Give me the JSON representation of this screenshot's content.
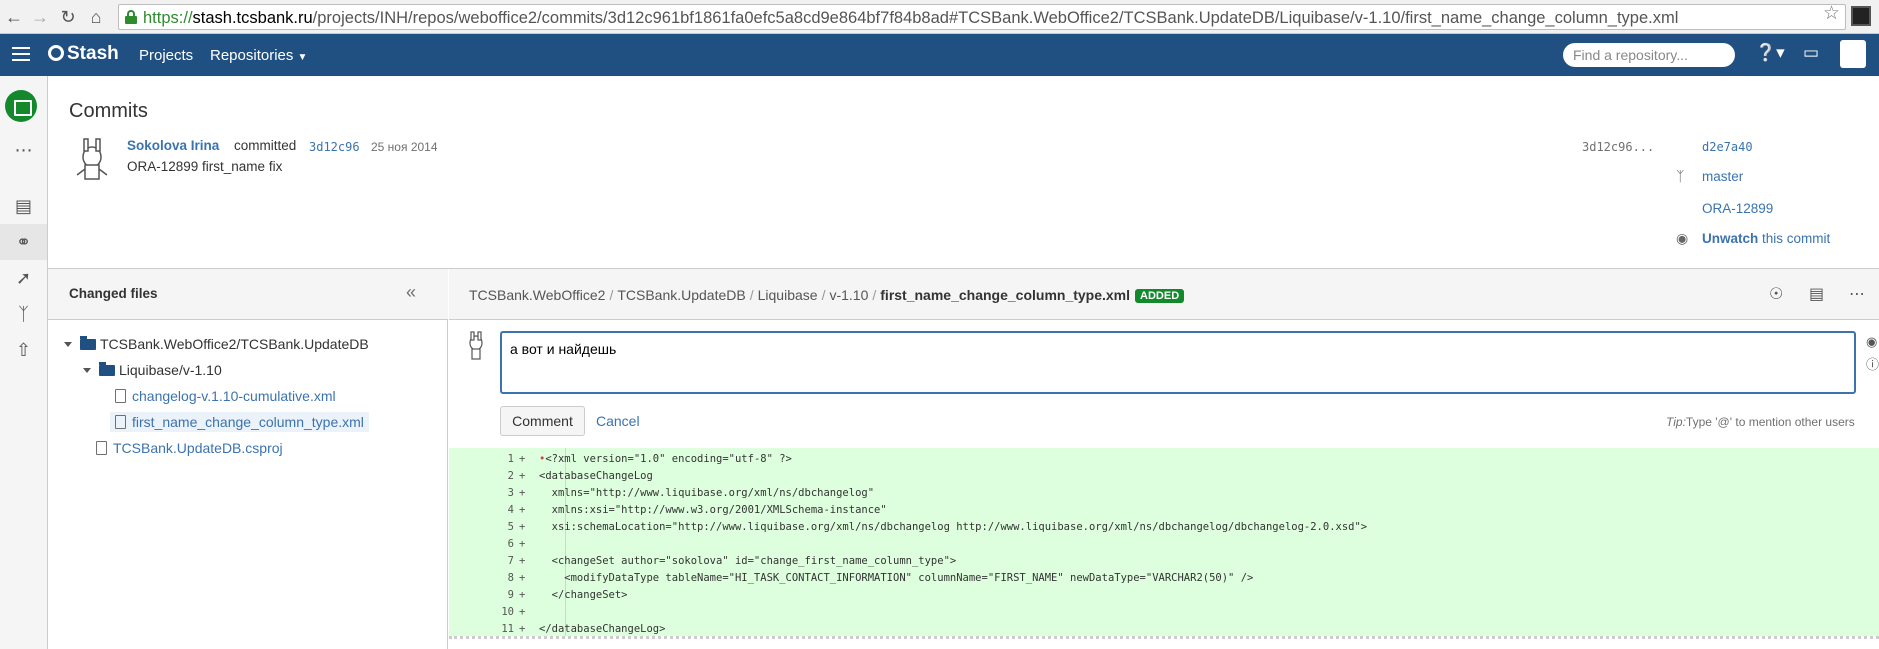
{
  "browser": {
    "url_scheme": "https://",
    "url_host": "stash.tcsbank.ru",
    "url_path": "/projects/INH/repos/weboffice2/commits/3d12c961bf1861fa0efc5a8cd9e864bf7f84b8ad#TCSBank.WebOffice2/TCSBank.UpdateDB/Liquibase/v-1.10/first_name_change_column_type.xml",
    "back_icon": "arrow-left-icon",
    "forward_icon": "arrow-right-icon",
    "reload_icon": "reload-icon",
    "home_icon": "home-icon",
    "star_icon": "bookmark-star-icon"
  },
  "header": {
    "logo": "Stash",
    "nav": [
      "Projects",
      "Repositories"
    ],
    "search_placeholder": "Find a repository...",
    "brand_color": "#205081"
  },
  "commit": {
    "page_title": "Commits",
    "author": "Sokolova Irina",
    "verb": "committed",
    "hash": "3d12c96",
    "date": "25 ноя 2014",
    "message": "ORA-12899 first_name fix",
    "parent_hash": "3d12c96...",
    "child_hash": "d2e7a40",
    "branch": "master",
    "issue": "ORA-12899",
    "unwatch_label": "Unwatch",
    "unwatch_suffix": "this commit"
  },
  "files": {
    "title": "Changed files",
    "tree": [
      {
        "label": "TCSBank.WebOffice2/TCSBank.UpdateDB",
        "type": "folder"
      },
      {
        "label": "Liquibase/v-1.10",
        "type": "folder"
      },
      {
        "label": "changelog-v.1.10-cumulative.xml",
        "type": "file"
      },
      {
        "label": "first_name_change_column_type.xml",
        "type": "file",
        "selected": true
      },
      {
        "label": "TCSBank.UpdateDB.csproj",
        "type": "file"
      }
    ]
  },
  "diff": {
    "crumbs": [
      "TCSBank.WebOffice2",
      "TCSBank.UpdateDB",
      "Liquibase",
      "v-1.10"
    ],
    "current_file": "first_name_change_column_type.xml",
    "badge": "ADDED",
    "comment_text": "а вот и найдешь",
    "comment_button": "Comment",
    "cancel_link": "Cancel",
    "tip_label": "Tip:",
    "tip_text": "Type '@' to mention other users",
    "lines": [
      {
        "n": "1",
        "text": "<?xml version=\"1.0\" encoding=\"utf-8\" ?>"
      },
      {
        "n": "2",
        "text": "<databaseChangeLog"
      },
      {
        "n": "3",
        "text": "  xmlns=\"http://www.liquibase.org/xml/ns/dbchangelog\""
      },
      {
        "n": "4",
        "text": "  xmlns:xsi=\"http://www.w3.org/2001/XMLSchema-instance\""
      },
      {
        "n": "5",
        "text": "  xsi:schemaLocation=\"http://www.liquibase.org/xml/ns/dbchangelog http://www.liquibase.org/xml/ns/dbchangelog/dbchangelog-2.0.xsd\">"
      },
      {
        "n": "6",
        "text": ""
      },
      {
        "n": "7",
        "text": "  <changeSet author=\"sokolova\" id=\"change_first_name_column_type\">"
      },
      {
        "n": "8",
        "text": "    <modifyDataType tableName=\"HI_TASK_CONTACT_INFORMATION\" columnName=\"FIRST_NAME\" newDataType=\"VARCHAR2(50)\" />"
      },
      {
        "n": "9",
        "text": "  </changeSet>"
      },
      {
        "n": "10",
        "text": ""
      },
      {
        "n": "11",
        "text": "</databaseChangeLog>"
      }
    ],
    "plus_sign": "+",
    "added_color": "#ddffdd"
  }
}
